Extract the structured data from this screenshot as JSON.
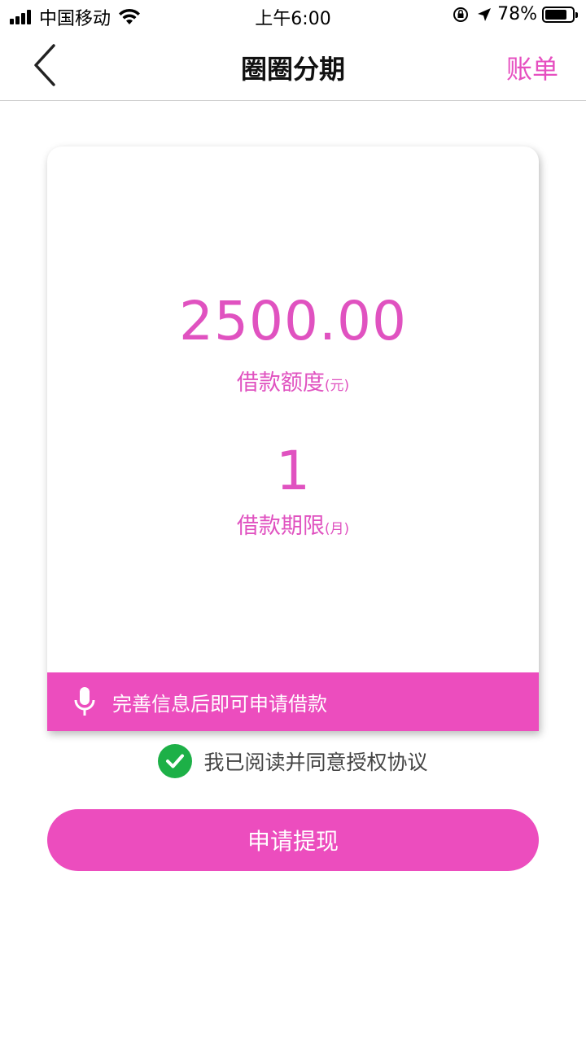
{
  "status_bar": {
    "carrier": "中国移动",
    "time": "上午6:00",
    "battery": "78%",
    "icons": [
      "signal-icon",
      "wifi-icon",
      "orientation-lock-icon",
      "location-icon",
      "battery-icon"
    ]
  },
  "nav": {
    "title": "圈圈分期",
    "action": "账单",
    "back_icon": "chevron-left-icon"
  },
  "loan": {
    "amount": "2500.00",
    "amount_label": "借款额度",
    "amount_unit": "(元)",
    "term": "1",
    "term_label": "借款期限",
    "term_unit": "(月)"
  },
  "notice": {
    "icon": "microphone-icon",
    "text": "完善信息后即可申请借款"
  },
  "agreement": {
    "checked": true,
    "text": "我已阅读并同意授权协议"
  },
  "submit": {
    "label": "申请提现"
  },
  "colors": {
    "accent": "#ec4dbe",
    "accent_text": "#e052c0",
    "check_green": "#1db047"
  }
}
